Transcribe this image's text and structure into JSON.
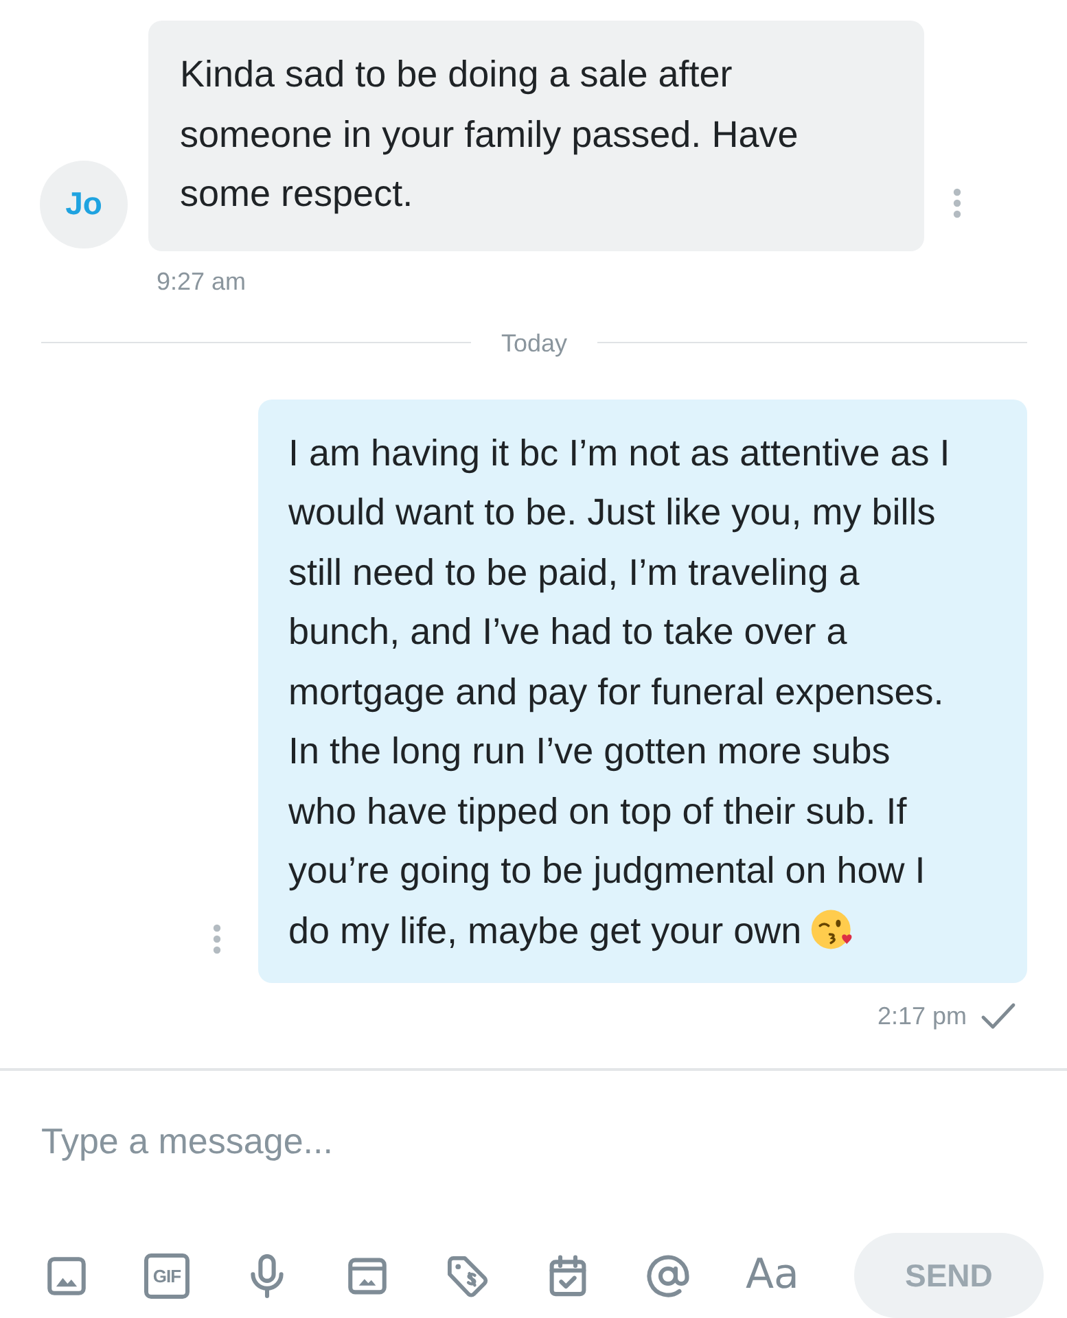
{
  "messages": [
    {
      "kind": "received",
      "avatar": "Jo",
      "text": "Kinda sad to be doing a sale after someone in your family passed. Have some respect.",
      "time": "9:27 am"
    },
    {
      "kind": "divider",
      "label": "Today"
    },
    {
      "kind": "sent",
      "text": "I am having it bc I’m not as attentive as I would want to be. Just like you, my bills still need to be paid, I’m traveling a bunch, and I’ve had to take over a mortgage and pay for funeral expenses. In the long run I’ve gotten more subs who have tipped on top of their sub. If you’re going to be judgmental on how I do my life, maybe get your own",
      "emoji": true,
      "time": "2:17 pm",
      "delivered": true
    }
  ],
  "composer": {
    "placeholder": "Type a message..."
  },
  "toolbar": [
    {
      "kind": "image"
    },
    {
      "kind": "gif",
      "label": "GIF"
    },
    {
      "kind": "mic"
    },
    {
      "kind": "media"
    },
    {
      "kind": "tag"
    },
    {
      "kind": "calendar"
    },
    {
      "kind": "mention"
    },
    {
      "kind": "format",
      "label": "Aa"
    }
  ],
  "send_button": {
    "label": "SEND",
    "disabled": true
  }
}
